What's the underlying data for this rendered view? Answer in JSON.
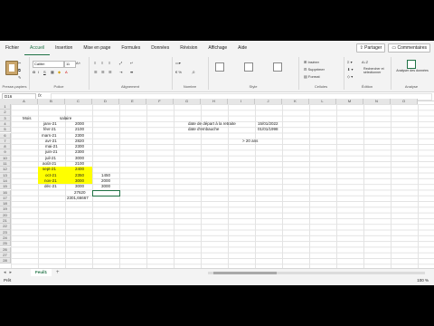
{
  "ribbon": {
    "tabs": [
      "Fichier",
      "Accueil",
      "Insertion",
      "Mise en page",
      "Formules",
      "Données",
      "Révision",
      "Affichage",
      "Aide"
    ],
    "active_tab": "Accueil",
    "share_label": "Partager",
    "comments_label": "Commentaires",
    "groups": {
      "clipboard_label": "Presse-papiers",
      "font_label": "Police",
      "alignment_label": "Alignement",
      "number_label": "Nombre",
      "styles_label": "Style",
      "cells_label": "Cellules",
      "editing_label": "Édition",
      "analysis_label": "Analyse"
    },
    "font_name": "Calibri",
    "font_size": "11",
    "cells_insert": "Insérer",
    "cells_delete": "Supprimer",
    "cells_format": "Format",
    "editing_find": "Rechercher et sélectionner",
    "analysis_btn": "Analyser des données"
  },
  "formula_bar": {
    "name_box": "D16",
    "fx": "fx",
    "value": ""
  },
  "columns": [
    "A",
    "B",
    "C",
    "D",
    "E",
    "F",
    "G",
    "H",
    "I",
    "J",
    "K",
    "L",
    "M",
    "N",
    "O"
  ],
  "rows": [
    "1",
    "2",
    "3",
    "4",
    "5",
    "6",
    "7",
    "8",
    "9",
    "10",
    "11",
    "12",
    "13",
    "14",
    "15",
    "16",
    "17",
    "18",
    "19",
    "20",
    "21",
    "22",
    "23",
    "24",
    "25",
    "26",
    "27",
    "28"
  ],
  "sheet": {
    "header_mois": "Mois",
    "header_salaire": "salaire",
    "months": [
      "janv-21",
      "févr-21",
      "mars-21",
      "avr-21",
      "mai-21",
      "juin-21",
      "juil-21",
      "août-21",
      "sept-21",
      "oct-21",
      "nov-21",
      "déc-21"
    ],
    "salaries": [
      "2000",
      "2100",
      "2300",
      "2820",
      "2300",
      "2300",
      "3000",
      "2100",
      "2400",
      "2350",
      "3000",
      "3000"
    ],
    "bonus_d": [
      "",
      "",
      "",
      "",
      "",
      "",
      "",
      "",
      "",
      "1450",
      "2000",
      "3000"
    ],
    "total": "27620",
    "average": "2301,66667",
    "label_depart": "date de départ à la retraite",
    "value_depart": "15/01/2022",
    "label_embauche": "date d'embauche",
    "value_embauche": "01/01/1998",
    "anciennete": "> 20 ans"
  },
  "sheet_tabs": [
    "Feuil1"
  ],
  "add_sheet": "+",
  "status": {
    "ready": "Prêt",
    "zoom": "100 %"
  },
  "colors": {
    "accent": "#217346",
    "highlight": "#ffff00"
  }
}
